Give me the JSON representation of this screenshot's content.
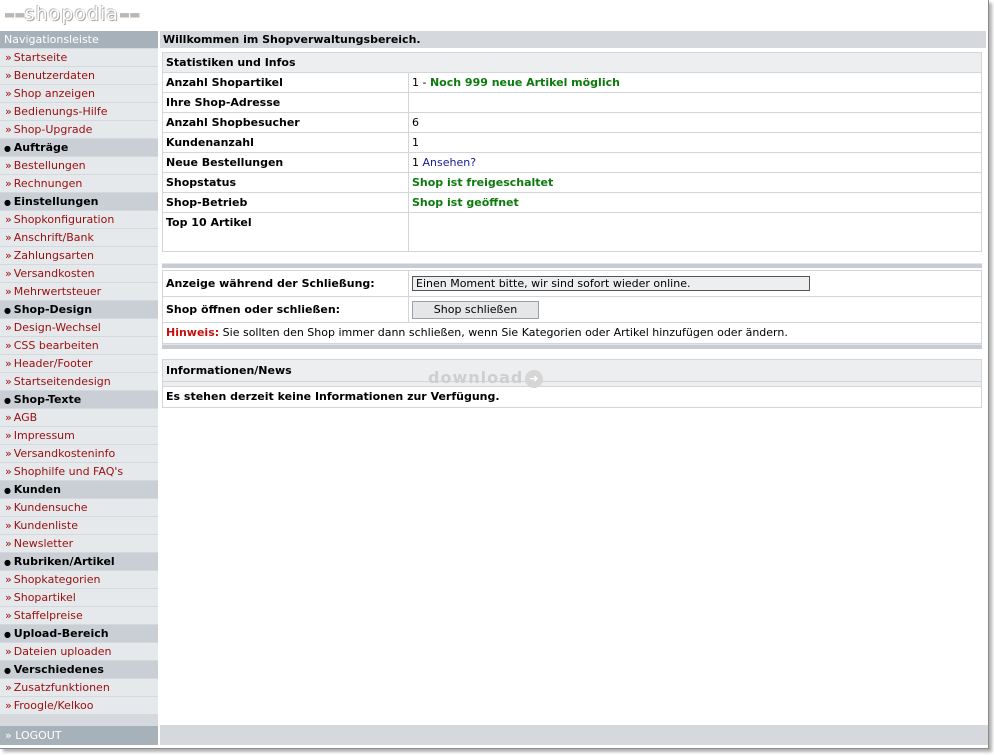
{
  "brand": {
    "logo_text": "shopodia"
  },
  "sidebar": {
    "header": "Navigationsleiste",
    "groups": [
      {
        "title": "",
        "items": [
          "Startseite",
          "Benutzerdaten",
          "Shop anzeigen",
          "Bedienungs-Hilfe",
          "Shop-Upgrade"
        ]
      },
      {
        "title": "Aufträge",
        "items": [
          "Bestellungen",
          "Rechnungen"
        ]
      },
      {
        "title": "Einstellungen",
        "items": [
          "Shopkonfiguration",
          "Anschrift/Bank",
          "Zahlungsarten",
          "Versandkosten",
          "Mehrwertsteuer"
        ]
      },
      {
        "title": "Shop-Design",
        "items": [
          "Design-Wechsel",
          "CSS bearbeiten",
          "Header/Footer",
          "Startseitendesign"
        ]
      },
      {
        "title": "Shop-Texte",
        "items": [
          "AGB",
          "Impressum",
          "Versandkosteninfo",
          "Shophilfe und FAQ's"
        ]
      },
      {
        "title": "Kunden",
        "items": [
          "Kundensuche",
          "Kundenliste",
          "Newsletter"
        ]
      },
      {
        "title": "Rubriken/Artikel",
        "items": [
          "Shopkategorien",
          "Shopartikel",
          "Staffelpreise"
        ]
      },
      {
        "title": "Upload-Bereich",
        "items": [
          "Dateien uploaden"
        ]
      },
      {
        "title": "Verschiedenes",
        "items": [
          "Zusatzfunktionen",
          "Froogle/Kelkoo"
        ]
      }
    ],
    "logout": "LOGOUT"
  },
  "main": {
    "welcome": "Willkommen im Shopverwaltungsbereich.",
    "stats": {
      "title": "Statistiken und Infos",
      "rows": {
        "articles_label": "Anzahl Shopartikel",
        "articles_count": "1 -",
        "articles_note": "Noch 999 neue Artikel möglich",
        "address_label": "Ihre Shop-Adresse",
        "address_value": "",
        "visitors_label": "Anzahl Shopbesucher",
        "visitors_value": "6",
        "customers_label": "Kundenanzahl",
        "customers_value": "1",
        "orders_label": "Neue Bestellungen",
        "orders_value": "1",
        "orders_link": "Ansehen?",
        "status_label": "Shopstatus",
        "status_value": "Shop ist freigeschaltet",
        "operation_label": "Shop-Betrieb",
        "operation_value": "Shop ist geöffnet",
        "top10_label": "Top 10 Artikel"
      }
    },
    "closing": {
      "message_label": "Anzeige während der Schließung:",
      "message_value": "Einen Moment bitte, wir sind sofort wieder online.",
      "toggle_label": "Shop öffnen oder schließen:",
      "toggle_button": "Shop schließen",
      "hint_label": "Hinweis:",
      "hint_text": "Sie sollten den Shop immer dann schließen, wenn Sie Kategorien oder Artikel hinzufügen oder ändern."
    },
    "news": {
      "title": "Informationen/News",
      "text": "Es stehen derzeit keine Informationen zur Verfügung."
    },
    "watermark": "download"
  },
  "colors": {
    "nav_link": "#9a0d0d",
    "positive": "#0c7a0c",
    "hint": "#c81010",
    "sidebar_bg": "#d5d9dd",
    "header_bg": "#a7b1ba"
  }
}
